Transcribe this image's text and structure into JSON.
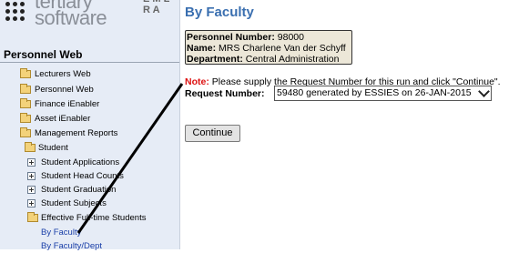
{
  "logo": {
    "line1": "tertiary",
    "line2": "software",
    "peek": "E M L R A"
  },
  "sidebar": {
    "app_title": "Personnel Web",
    "items": [
      {
        "label": "Lecturers Web"
      },
      {
        "label": "Personnel Web"
      },
      {
        "label": "Finance iEnabler"
      },
      {
        "label": "Asset iEnabler"
      },
      {
        "label": "Management Reports"
      },
      {
        "label": "Student"
      },
      {
        "label": "Student Applications"
      },
      {
        "label": "Student Head Counts"
      },
      {
        "label": "Student Graduation"
      },
      {
        "label": "Student Subjects"
      },
      {
        "label": "Effective Full-time Students"
      },
      {
        "label": "By Faculty"
      },
      {
        "label": "By Faculty/Dept"
      }
    ]
  },
  "main": {
    "title": "By Faculty",
    "info": {
      "personnel_number_label": "Personnel Number:",
      "personnel_number": "98000",
      "name_label": "Name:",
      "name": "MRS Charlene Van der Schyff",
      "department_label": "Department:",
      "department": "Central Administration"
    },
    "note_label": "Note:",
    "note_text": "Please supply the Request Number for this run and click \"Continue\".",
    "request_label": "Request Number:",
    "request_value": "59480 generated by ESSIES on 26-JAN-2015",
    "continue_label": "Continue"
  },
  "colors": {
    "title": "#3a6fb0",
    "note_label": "#dd1111",
    "link": "#1a3fa8",
    "sidebar_bg": "#e6ecf6",
    "info_bg": "#ece7d8"
  }
}
